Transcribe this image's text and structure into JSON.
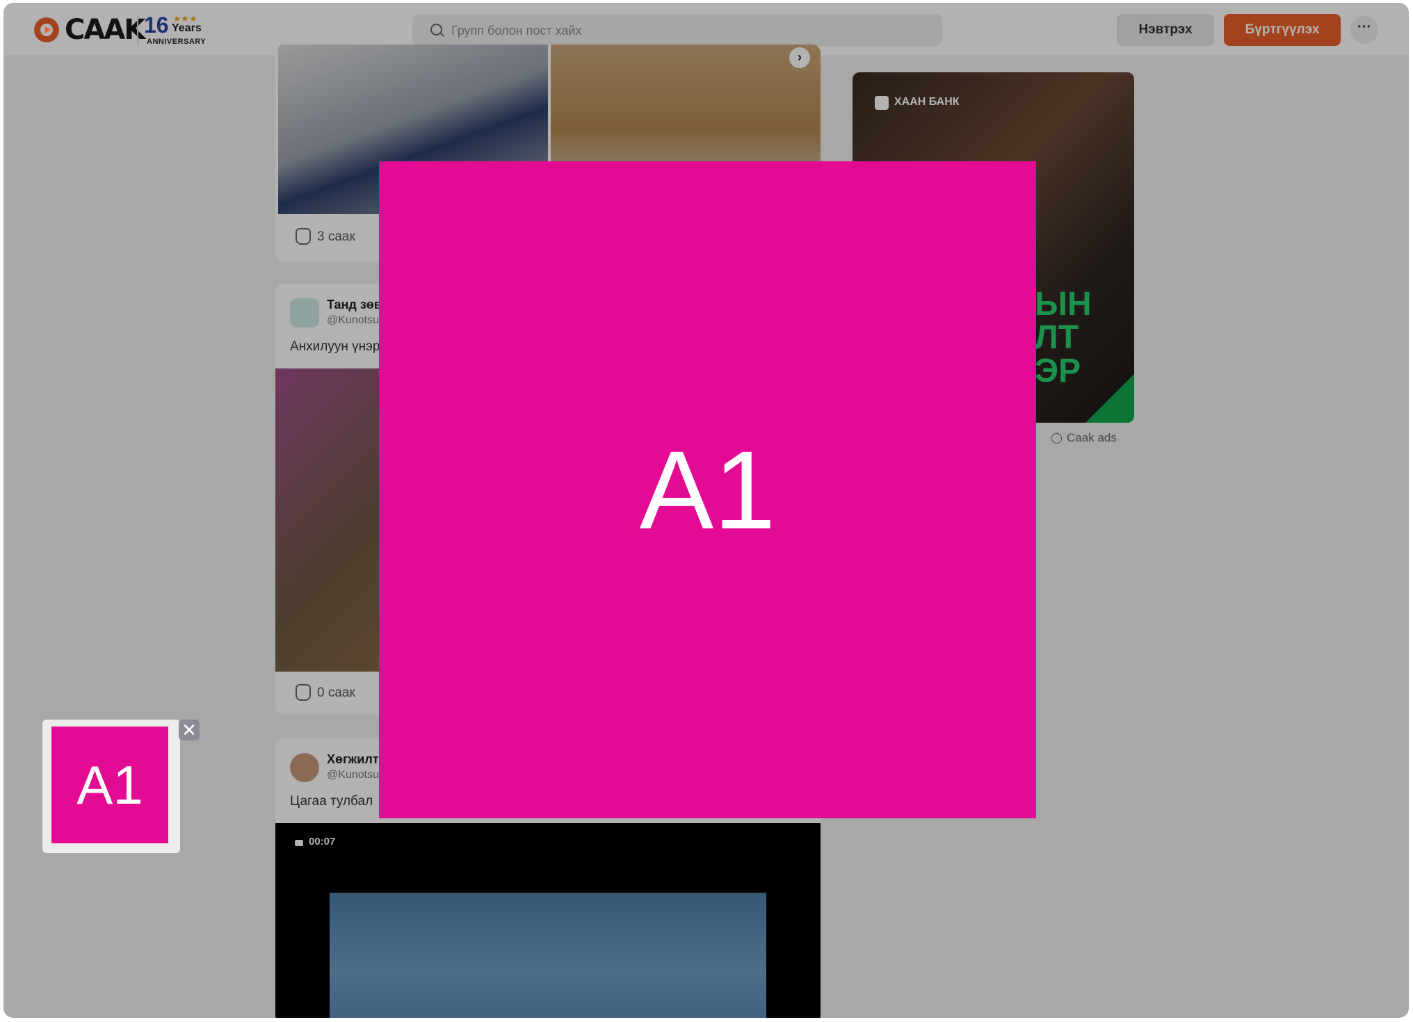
{
  "header": {
    "logo_text": "CAAK",
    "anniversary": {
      "number": "16",
      "stars": "★★★",
      "years": "Years",
      "label": "ANNIVERSARY"
    },
    "search_placeholder": "Групп болон пост хайх",
    "login_label": "Нэвтрэх",
    "register_label": "Бүртгүүлэх",
    "more_label": "···"
  },
  "feed": {
    "posts": [
      {
        "caak_count": "3 саак"
      },
      {
        "author": "Танд зөв",
        "handle": "@Kunotsu",
        "caption": "Анхилуун үнэр",
        "caak_count": "0 саак"
      },
      {
        "author": "Хөгжилт",
        "handle": "@Kunotsu",
        "caption": "Цагаа тулбал",
        "video_duration": "00:07"
      }
    ]
  },
  "sidebar_ad": {
    "brand": "ХААН БАНК",
    "slogan": "ЫН\nЛТ\nЭР",
    "label": "Caak ads"
  },
  "overlay": {
    "popup_label": "A1",
    "side_ad_label": "A1",
    "close_symbol": "✕"
  }
}
